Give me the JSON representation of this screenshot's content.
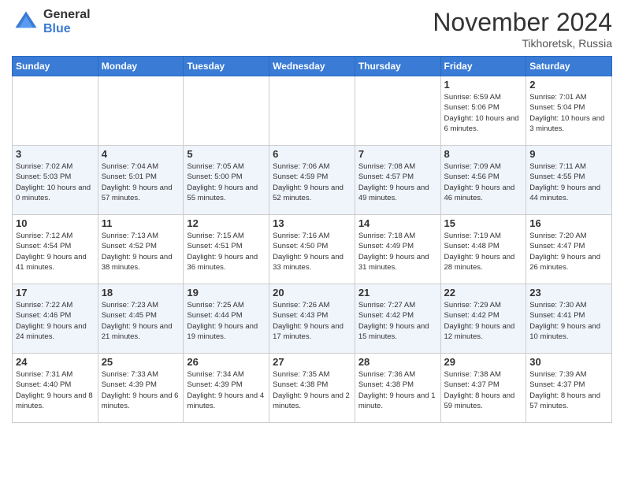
{
  "header": {
    "logo_general": "General",
    "logo_blue": "Blue",
    "title": "November 2024",
    "location": "Tikhoretsk, Russia"
  },
  "days_of_week": [
    "Sunday",
    "Monday",
    "Tuesday",
    "Wednesday",
    "Thursday",
    "Friday",
    "Saturday"
  ],
  "weeks": [
    [
      {
        "day": "",
        "info": ""
      },
      {
        "day": "",
        "info": ""
      },
      {
        "day": "",
        "info": ""
      },
      {
        "day": "",
        "info": ""
      },
      {
        "day": "",
        "info": ""
      },
      {
        "day": "1",
        "info": "Sunrise: 6:59 AM\nSunset: 5:06 PM\nDaylight: 10 hours and 6 minutes."
      },
      {
        "day": "2",
        "info": "Sunrise: 7:01 AM\nSunset: 5:04 PM\nDaylight: 10 hours and 3 minutes."
      }
    ],
    [
      {
        "day": "3",
        "info": "Sunrise: 7:02 AM\nSunset: 5:03 PM\nDaylight: 10 hours and 0 minutes."
      },
      {
        "day": "4",
        "info": "Sunrise: 7:04 AM\nSunset: 5:01 PM\nDaylight: 9 hours and 57 minutes."
      },
      {
        "day": "5",
        "info": "Sunrise: 7:05 AM\nSunset: 5:00 PM\nDaylight: 9 hours and 55 minutes."
      },
      {
        "day": "6",
        "info": "Sunrise: 7:06 AM\nSunset: 4:59 PM\nDaylight: 9 hours and 52 minutes."
      },
      {
        "day": "7",
        "info": "Sunrise: 7:08 AM\nSunset: 4:57 PM\nDaylight: 9 hours and 49 minutes."
      },
      {
        "day": "8",
        "info": "Sunrise: 7:09 AM\nSunset: 4:56 PM\nDaylight: 9 hours and 46 minutes."
      },
      {
        "day": "9",
        "info": "Sunrise: 7:11 AM\nSunset: 4:55 PM\nDaylight: 9 hours and 44 minutes."
      }
    ],
    [
      {
        "day": "10",
        "info": "Sunrise: 7:12 AM\nSunset: 4:54 PM\nDaylight: 9 hours and 41 minutes."
      },
      {
        "day": "11",
        "info": "Sunrise: 7:13 AM\nSunset: 4:52 PM\nDaylight: 9 hours and 38 minutes."
      },
      {
        "day": "12",
        "info": "Sunrise: 7:15 AM\nSunset: 4:51 PM\nDaylight: 9 hours and 36 minutes."
      },
      {
        "day": "13",
        "info": "Sunrise: 7:16 AM\nSunset: 4:50 PM\nDaylight: 9 hours and 33 minutes."
      },
      {
        "day": "14",
        "info": "Sunrise: 7:18 AM\nSunset: 4:49 PM\nDaylight: 9 hours and 31 minutes."
      },
      {
        "day": "15",
        "info": "Sunrise: 7:19 AM\nSunset: 4:48 PM\nDaylight: 9 hours and 28 minutes."
      },
      {
        "day": "16",
        "info": "Sunrise: 7:20 AM\nSunset: 4:47 PM\nDaylight: 9 hours and 26 minutes."
      }
    ],
    [
      {
        "day": "17",
        "info": "Sunrise: 7:22 AM\nSunset: 4:46 PM\nDaylight: 9 hours and 24 minutes."
      },
      {
        "day": "18",
        "info": "Sunrise: 7:23 AM\nSunset: 4:45 PM\nDaylight: 9 hours and 21 minutes."
      },
      {
        "day": "19",
        "info": "Sunrise: 7:25 AM\nSunset: 4:44 PM\nDaylight: 9 hours and 19 minutes."
      },
      {
        "day": "20",
        "info": "Sunrise: 7:26 AM\nSunset: 4:43 PM\nDaylight: 9 hours and 17 minutes."
      },
      {
        "day": "21",
        "info": "Sunrise: 7:27 AM\nSunset: 4:42 PM\nDaylight: 9 hours and 15 minutes."
      },
      {
        "day": "22",
        "info": "Sunrise: 7:29 AM\nSunset: 4:42 PM\nDaylight: 9 hours and 12 minutes."
      },
      {
        "day": "23",
        "info": "Sunrise: 7:30 AM\nSunset: 4:41 PM\nDaylight: 9 hours and 10 minutes."
      }
    ],
    [
      {
        "day": "24",
        "info": "Sunrise: 7:31 AM\nSunset: 4:40 PM\nDaylight: 9 hours and 8 minutes."
      },
      {
        "day": "25",
        "info": "Sunrise: 7:33 AM\nSunset: 4:39 PM\nDaylight: 9 hours and 6 minutes."
      },
      {
        "day": "26",
        "info": "Sunrise: 7:34 AM\nSunset: 4:39 PM\nDaylight: 9 hours and 4 minutes."
      },
      {
        "day": "27",
        "info": "Sunrise: 7:35 AM\nSunset: 4:38 PM\nDaylight: 9 hours and 2 minutes."
      },
      {
        "day": "28",
        "info": "Sunrise: 7:36 AM\nSunset: 4:38 PM\nDaylight: 9 hours and 1 minute."
      },
      {
        "day": "29",
        "info": "Sunrise: 7:38 AM\nSunset: 4:37 PM\nDaylight: 8 hours and 59 minutes."
      },
      {
        "day": "30",
        "info": "Sunrise: 7:39 AM\nSunset: 4:37 PM\nDaylight: 8 hours and 57 minutes."
      }
    ]
  ]
}
